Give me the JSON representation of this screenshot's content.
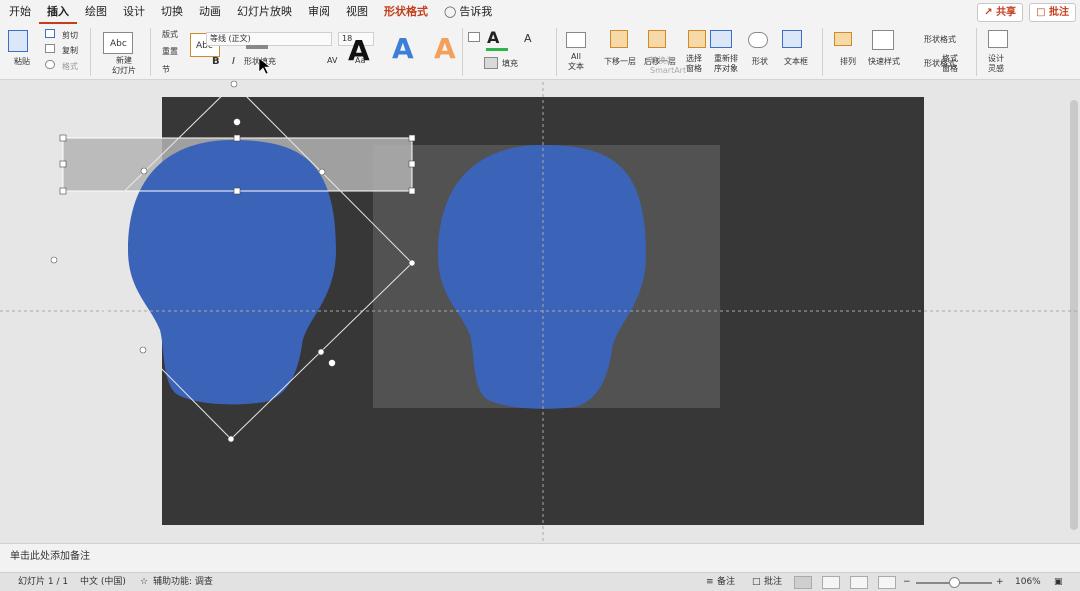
{
  "tabs": [
    "开始",
    "插入",
    "绘图",
    "设计",
    "切换",
    "动画",
    "幻灯片放映",
    "审阅",
    "视图",
    "形状格式",
    "告诉我"
  ],
  "active_tab": "插入",
  "context_tab": "形状格式",
  "share_label": "共享",
  "comments_label": "批注",
  "ribbon": {
    "paste": "粘贴",
    "cut": "剪切",
    "copy": "复制",
    "format": "格式",
    "new_slide": "新建\n幻灯片",
    "layout": "版式",
    "reset": "重置",
    "section": "节",
    "font_name": "等线 (正文)",
    "font_size": "18",
    "shape_fill": "形状填充",
    "bold": "B",
    "italic": "I",
    "shapes_styles_a": "A",
    "fill_label": "填充",
    "convert_text": "转换为\nSmartArt",
    "all_text": "All\n文本",
    "down_one": "下移一层",
    "back_one": "后移一层",
    "select_pane": "选择\n窗格",
    "rearrange": "重新排\n序对象",
    "shapes": "形状",
    "textbox": "文本框",
    "arrange": "排列",
    "quick_styles": "快速样式",
    "shape_format": "形状格式",
    "format_pane": "格式\n窗格",
    "designer": "设计\n灵感",
    "abc": "Abc",
    "av": "AV",
    "aa": "Aa"
  },
  "notes_placeholder": "单击此处添加备注",
  "status": {
    "slide_count": "幻灯片 1 / 1",
    "language": "中文 (中国)",
    "accessibility": "辅助功能: 调查",
    "notes_btn": "备注",
    "comments_btn": "批注",
    "zoom": "106%"
  },
  "colors": {
    "accent": "#c43e1c",
    "shape_blue": "#3b63b8",
    "slide_bg": "#373737",
    "gray_box": "#525252",
    "light_gray_rect": "#b3b3b3"
  },
  "icons": [
    "paste-icon",
    "cut-icon",
    "copy-icon",
    "format-painter-icon",
    "lightbulb-icon",
    "share-icon",
    "comment-icon",
    "notes-icon",
    "normal-view-icon",
    "slide-sorter-icon",
    "reading-view-icon",
    "slideshow-icon",
    "fit-window-icon"
  ]
}
